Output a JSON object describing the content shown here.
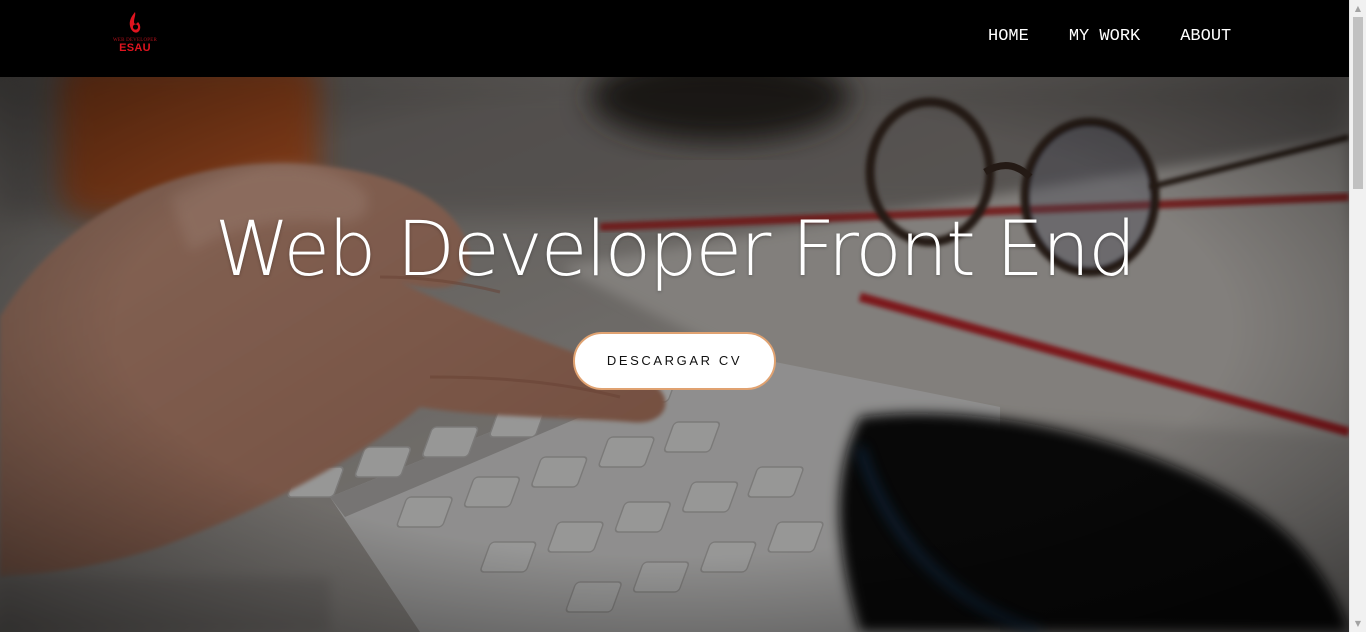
{
  "brand": {
    "tagline": "WEB DEVELOPER",
    "name": "ESAU",
    "color": "#e0141f"
  },
  "nav": {
    "items": [
      {
        "label": "HOME"
      },
      {
        "label": "MY WORK"
      },
      {
        "label": "ABOUT"
      }
    ]
  },
  "hero": {
    "title": "Web Developer Front End",
    "button_label": "DESCARGAR CV",
    "button_border_color": "#e0a271",
    "background": "photo of hands typing on a white keyboard next to eyeglasses and a notebook"
  },
  "scrollbar": {
    "up_icon": "▲",
    "down_icon": "▼"
  }
}
